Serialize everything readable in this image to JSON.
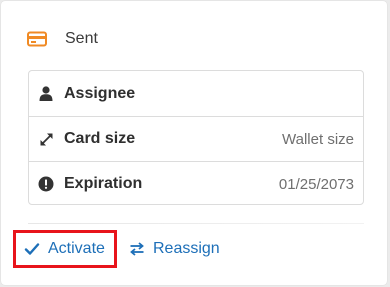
{
  "status": {
    "label": "Sent",
    "icon": "credit-card-icon",
    "icon_color": "#f08a24"
  },
  "details": [
    {
      "icon": "user-icon",
      "name": "Assignee",
      "value": ""
    },
    {
      "icon": "expand-arrows-icon",
      "name": "Card size",
      "value": "Wallet size"
    },
    {
      "icon": "exclamation-circle-icon",
      "name": "Expiration",
      "value": "01/25/2073"
    }
  ],
  "actions": {
    "activate_label": "Activate",
    "activate_icon": "checkmark-icon",
    "reassign_label": "Reassign",
    "reassign_icon": "swap-arrows-icon",
    "link_color": "#1d6fb8",
    "highlight_color": "#e8141b"
  }
}
